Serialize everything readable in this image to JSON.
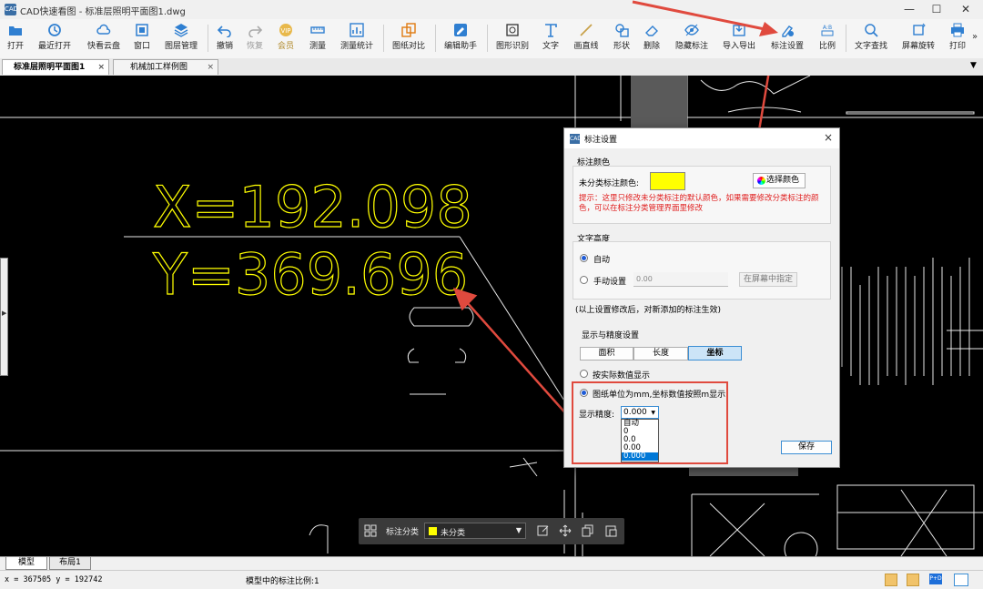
{
  "window": {
    "title": "CAD快速看图 - 标准层照明平面图1.dwg",
    "icon_label": "CAD"
  },
  "toolbar": {
    "items": [
      {
        "label": "打开",
        "icon": "folder-open-icon"
      },
      {
        "label": "最近打开",
        "icon": "clock-icon"
      },
      {
        "label": "快看云盘",
        "icon": "cloud-icon"
      },
      {
        "label": "窗口",
        "icon": "window-icon"
      },
      {
        "label": "图层管理",
        "icon": "layers-icon"
      },
      {
        "label": "撤销",
        "icon": "undo-icon"
      },
      {
        "label": "恢复",
        "icon": "redo-icon"
      },
      {
        "label": "会员",
        "icon": "vip-icon"
      },
      {
        "label": "测量",
        "icon": "ruler-icon"
      },
      {
        "label": "测量统计",
        "icon": "stats-icon"
      },
      {
        "label": "图纸对比",
        "icon": "compare-icon"
      },
      {
        "label": "编辑助手",
        "icon": "edit-assistant-icon"
      },
      {
        "label": "图形识别",
        "icon": "shape-recognize-icon"
      },
      {
        "label": "文字",
        "icon": "text-icon"
      },
      {
        "label": "画直线",
        "icon": "line-icon"
      },
      {
        "label": "形状",
        "icon": "shape-icon"
      },
      {
        "label": "删除",
        "icon": "eraser-icon"
      },
      {
        "label": "隐藏标注",
        "icon": "eye-icon"
      },
      {
        "label": "导入导出",
        "icon": "import-export-icon"
      },
      {
        "label": "标注设置",
        "icon": "annotation-settings-icon"
      },
      {
        "label": "比例",
        "icon": "scale-icon"
      },
      {
        "label": "文字查找",
        "icon": "text-search-icon"
      },
      {
        "label": "屏幕旋转",
        "icon": "rotate-screen-icon"
      },
      {
        "label": "打印",
        "icon": "printer-icon"
      }
    ],
    "more": "»"
  },
  "tabs": [
    {
      "label": "标准层照明平面图1",
      "active": true,
      "close": "×"
    },
    {
      "label": "机械加工样例图",
      "active": false,
      "close": "×"
    }
  ],
  "drawing": {
    "x_text": "X=192.098",
    "y_text": "Y=369.696",
    "colors": {
      "annotation": "#ffff00",
      "lines": "#ffffff",
      "arrow": "#e04a3e"
    }
  },
  "dialog": {
    "title": "标注设置",
    "color_section": {
      "heading": "标注颜色",
      "label": "未分类标注颜色:",
      "swatch_color": "#ffff00",
      "pick_button": "选择颜色",
      "hint": "提示：这里只修改未分类标注的默认颜色，如果需要修改分类标注的颜色，可以在标注分类管理界面里修改"
    },
    "text_height": {
      "heading": "文字高度",
      "auto_label": "自动",
      "manual_label": "手动设置",
      "manual_value": "0.00",
      "screen_button": "在屏幕中指定"
    },
    "note": "(以上设置修改后，对新添加的标注生效)",
    "precision_section": {
      "heading": "显示与精度设置",
      "tabs": [
        "面积",
        "长度",
        "坐标"
      ],
      "active_tab": "坐标",
      "option_actual": "按实际数值显示",
      "option_unit": "图纸单位为mm,坐标数值按照m显示",
      "precision_label": "显示精度:",
      "precision_value": "0.000",
      "dropdown_options": [
        "自动",
        "0",
        "0.0",
        "0.00",
        "0.000"
      ],
      "selected_option": "0.000"
    },
    "save_button": "保存",
    "close": "×"
  },
  "bottom_toolbar": {
    "label": "标注分类",
    "select_value": "未分类",
    "select_color": "#ffff00"
  },
  "layout_tabs": [
    "模型",
    "布局1"
  ],
  "statusbar": {
    "coords": "x = 367505  y = 192742",
    "scale_text": "模型中的标注比例:1"
  }
}
